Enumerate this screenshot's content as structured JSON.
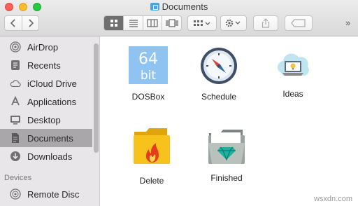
{
  "window": {
    "title": "Documents"
  },
  "toolbar": {
    "back": "<",
    "forward": ">",
    "overflow": "»"
  },
  "sidebar": {
    "items": [
      {
        "label": "AirDrop",
        "icon": "airdrop-icon"
      },
      {
        "label": "Recents",
        "icon": "recents-icon"
      },
      {
        "label": "iCloud Drive",
        "icon": "cloud-icon"
      },
      {
        "label": "Applications",
        "icon": "applications-icon"
      },
      {
        "label": "Desktop",
        "icon": "desktop-icon"
      },
      {
        "label": "Documents",
        "icon": "documents-icon",
        "selected": true
      },
      {
        "label": "Downloads",
        "icon": "downloads-icon"
      }
    ],
    "devices_heading": "Devices",
    "devices": [
      {
        "label": "Remote Disc",
        "icon": "disc-icon"
      }
    ]
  },
  "files": [
    {
      "name": "DOSBox",
      "icon": "dosbox-icon",
      "badge": [
        "64",
        "bit"
      ]
    },
    {
      "name": "Schedule",
      "icon": "compass-icon"
    },
    {
      "name": "Ideas",
      "icon": "ideas-icon"
    },
    {
      "name": "Delete",
      "icon": "fire-folder-icon"
    },
    {
      "name": "Finished",
      "icon": "gem-folder-icon"
    }
  ],
  "watermark": "wsxdn.com"
}
